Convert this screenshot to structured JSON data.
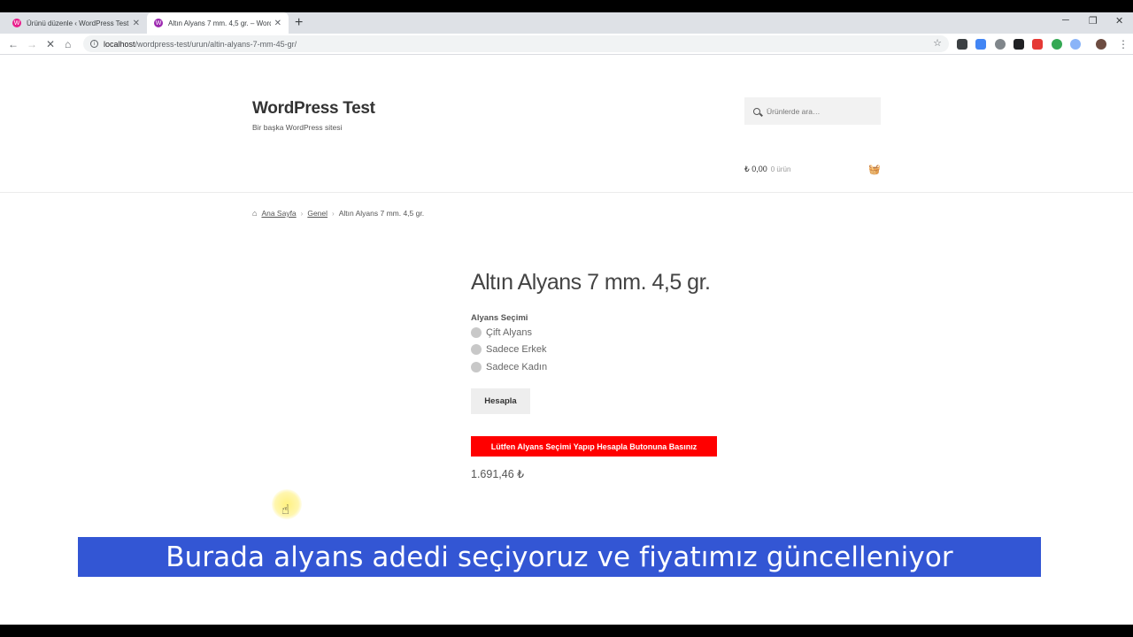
{
  "browser": {
    "tabs": [
      {
        "title": "Ürünü düzenle ‹ WordPress Test — WordPress",
        "active": false
      },
      {
        "title": "Altın Alyans 7 mm. 4,5 gr. – WordPress Test",
        "active": true
      }
    ],
    "new_tab": "+",
    "close": "✕",
    "window_min": "─",
    "window_restore": "❐",
    "window_close": "✕",
    "url_host": "localhost",
    "url_path": "/wordpress-test/urun/altin-alyans-7-mm-45-gr/"
  },
  "site": {
    "title": "WordPress Test",
    "tagline": "Bir başka WordPress sitesi",
    "search_placeholder": "Ürünlerde ara…",
    "cart_total": "₺ 0,00",
    "cart_count": "0 ürün"
  },
  "breadcrumb": {
    "home": "Ana Sayfa",
    "category": "Genel",
    "current": "Altın Alyans 7 mm. 4,5 gr."
  },
  "product": {
    "title": "Altın Alyans 7 mm. 4,5 gr.",
    "option_label": "Alyans Seçimi",
    "options": [
      "Çift Alyans",
      "Sadece Erkek",
      "Sadece Kadın"
    ],
    "calc_button": "Hesapla",
    "notice": "Lütfen Alyans Seçimi Yapıp Hesapla Butonuna Basınız",
    "price": "1.691,46 ₺"
  },
  "caption": "Burada alyans adedi seçiyoruz ve fiyatımız güncelleniyor",
  "colors": {
    "notice_bg": "#ff0000",
    "caption_bg": "#3356d4"
  }
}
